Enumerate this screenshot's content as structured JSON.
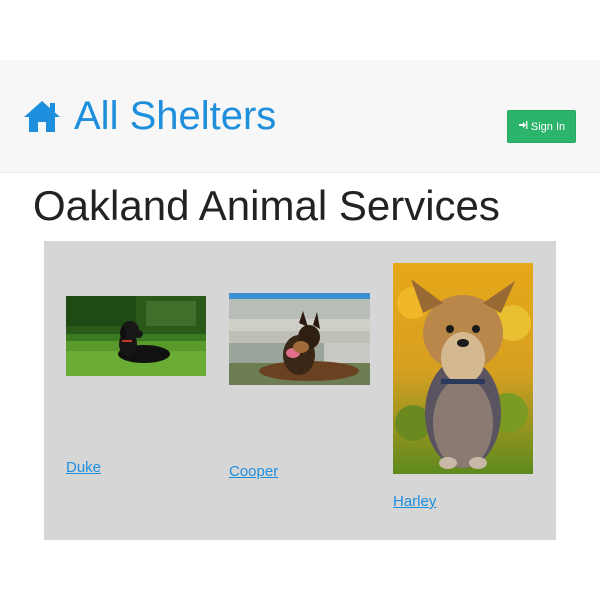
{
  "navbar": {
    "brand_label": "All Shelters",
    "brand_icon": "home-icon",
    "signin_label": "Sign In",
    "signin_icon": "sign-in-icon",
    "accent_color": "#1d8fdc",
    "signin_color": "#2cb46b"
  },
  "page": {
    "title": "Oakland Animal Services"
  },
  "pets": [
    {
      "name": "Duke"
    },
    {
      "name": "Cooper"
    },
    {
      "name": "Harley"
    }
  ]
}
